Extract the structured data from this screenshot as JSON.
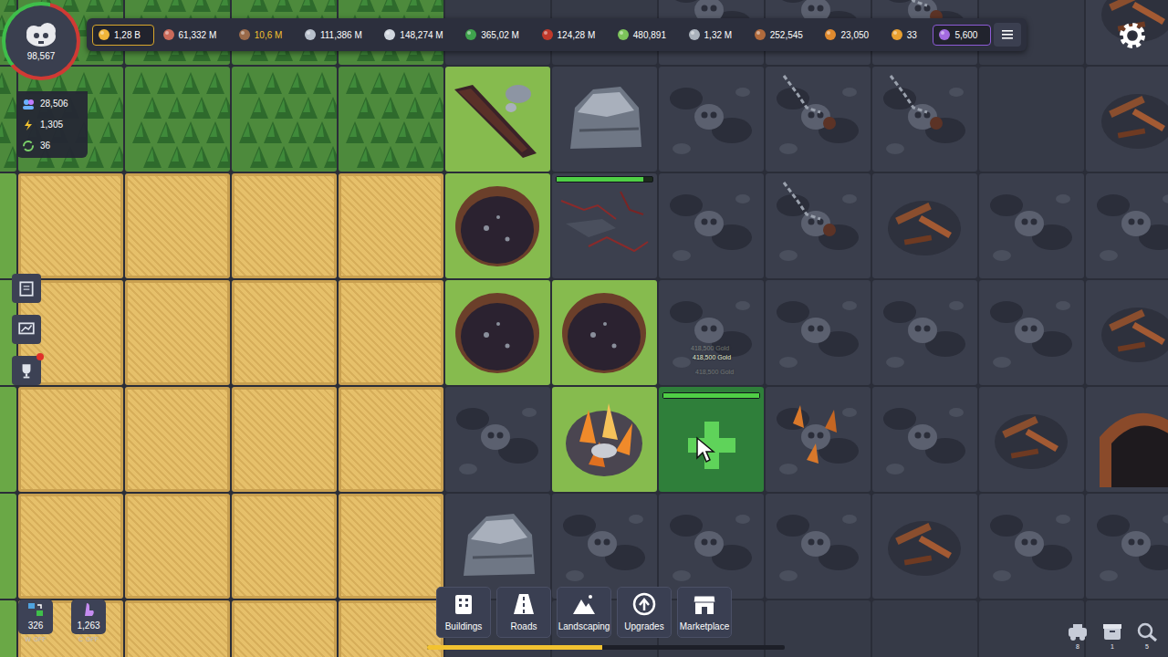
{
  "top_bar": {
    "resources": [
      {
        "value": "1,28 B",
        "highlighted": true,
        "color": "#d9a72c",
        "capped": false
      },
      {
        "value": "61,332 M",
        "highlighted": false,
        "capped": false
      },
      {
        "value": "10,6 M",
        "highlighted": false,
        "capped": true
      },
      {
        "value": "111,386 M",
        "highlighted": false,
        "capped": false
      },
      {
        "value": "148,274 M",
        "highlighted": false,
        "capped": false
      },
      {
        "value": "365,02 M",
        "highlighted": false,
        "capped": false
      },
      {
        "value": "124,28 M",
        "highlighted": false,
        "capped": false
      },
      {
        "value": "480,891",
        "highlighted": false,
        "capped": false
      },
      {
        "value": "1,32 M",
        "highlighted": false,
        "capped": false
      },
      {
        "value": "252,545",
        "highlighted": false,
        "capped": false
      },
      {
        "value": "23,050",
        "highlighted": false,
        "capped": false
      },
      {
        "value": "33",
        "highlighted": false,
        "capped": false
      },
      {
        "value": "5,600",
        "highlighted": true,
        "color": "#8d5bd6",
        "capped": false
      }
    ]
  },
  "player": {
    "score": "98,567",
    "level": 0.4
  },
  "stats": [
    {
      "value": "28,506"
    },
    {
      "value": "1,305"
    },
    {
      "value": "36"
    }
  ],
  "side_buttons": [
    {
      "notification": false
    },
    {
      "notification": false
    },
    {
      "notification": true
    }
  ],
  "toggles": [
    {
      "value": "326",
      "key": "W",
      "status": "OFF"
    },
    {
      "value": "1,263",
      "key": "C",
      "status": "OFF"
    }
  ],
  "toolbar": {
    "buttons": [
      {
        "label": "Buildings"
      },
      {
        "label": "Roads"
      },
      {
        "label": "Landscaping"
      },
      {
        "label": "Upgrades"
      },
      {
        "label": "Marketplace"
      }
    ],
    "level": 0.49
  },
  "corner_buttons": [
    {
      "badge": "8"
    },
    {
      "badge": "1"
    },
    {
      "badge": "5"
    }
  ],
  "floating_texts": [
    "418,500 Gold",
    "418,500 Gold",
    "418,500 Gold"
  ],
  "map": {
    "rows": [
      [
        {
          "kind": "trees"
        },
        {
          "kind": "trees"
        },
        {
          "kind": "trees"
        },
        {
          "kind": "trees"
        },
        {
          "kind": "trees"
        },
        {
          "kind": "dark"
        },
        {
          "kind": "dark"
        },
        {
          "kind": "rubble"
        },
        {
          "kind": "rubble"
        },
        {
          "kind": "scrap"
        },
        {
          "kind": "dark"
        },
        {
          "kind": "debris"
        }
      ],
      [
        {
          "kind": "trees"
        },
        {
          "kind": "trees"
        },
        {
          "kind": "trees"
        },
        {
          "kind": "trees"
        },
        {
          "kind": "trees"
        },
        {
          "kind": "ditch"
        },
        {
          "kind": "rockpile"
        },
        {
          "kind": "rubble"
        },
        {
          "kind": "scrap"
        },
        {
          "kind": "scrap"
        },
        {
          "kind": "dark"
        },
        {
          "kind": "debris"
        }
      ],
      [
        {
          "kind": "grass"
        },
        {
          "kind": "wheat"
        },
        {
          "kind": "wheat"
        },
        {
          "kind": "wheat"
        },
        {
          "kind": "wheat"
        },
        {
          "kind": "pit"
        },
        {
          "kind": "cracked",
          "level": 0.9
        },
        {
          "kind": "rubble"
        },
        {
          "kind": "scrap"
        },
        {
          "kind": "debris"
        },
        {
          "kind": "rubble"
        },
        {
          "kind": "rubble"
        }
      ],
      [
        {
          "kind": "grass"
        },
        {
          "kind": "wheat"
        },
        {
          "kind": "wheat"
        },
        {
          "kind": "wheat"
        },
        {
          "kind": "wheat"
        },
        {
          "kind": "pit"
        },
        {
          "kind": "pit"
        },
        {
          "kind": "rubble"
        },
        {
          "kind": "rubble"
        },
        {
          "kind": "rubble"
        },
        {
          "kind": "rubble"
        },
        {
          "kind": "debris"
        }
      ],
      [
        {
          "kind": "grass"
        },
        {
          "kind": "wheat"
        },
        {
          "kind": "wheat"
        },
        {
          "kind": "wheat"
        },
        {
          "kind": "wheat"
        },
        {
          "kind": "rubble"
        },
        {
          "kind": "crystal"
        },
        {
          "kind": "selected",
          "level": 1
        },
        {
          "kind": "shards"
        },
        {
          "kind": "rubble"
        },
        {
          "kind": "debris"
        },
        {
          "kind": "cave"
        }
      ],
      [
        {
          "kind": "grass"
        },
        {
          "kind": "wheat"
        },
        {
          "kind": "wheat"
        },
        {
          "kind": "wheat"
        },
        {
          "kind": "wheat"
        },
        {
          "kind": "rockpile"
        },
        {
          "kind": "rubble"
        },
        {
          "kind": "rubble"
        },
        {
          "kind": "rubble"
        },
        {
          "kind": "debris"
        },
        {
          "kind": "rubble"
        },
        {
          "kind": "rubble"
        }
      ],
      [
        {
          "kind": "grass"
        },
        {
          "kind": "wheat"
        },
        {
          "kind": "wheat"
        },
        {
          "kind": "wheat"
        },
        {
          "kind": "wheat"
        },
        {
          "kind": "dark"
        },
        {
          "kind": "dark"
        },
        {
          "kind": "dark"
        },
        {
          "kind": "dark"
        },
        {
          "kind": "dark"
        },
        {
          "kind": "dark"
        },
        {
          "kind": "dark"
        }
      ]
    ]
  }
}
